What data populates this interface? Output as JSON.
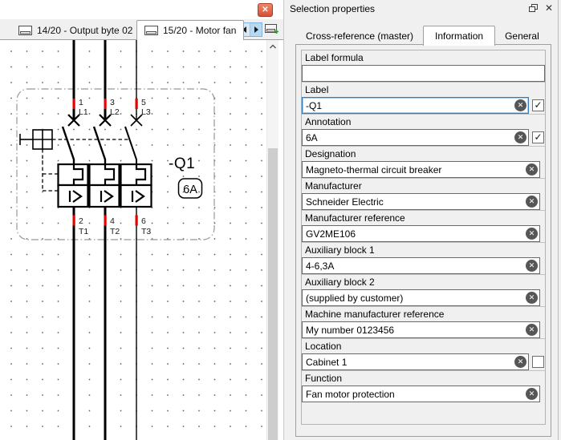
{
  "icons": {
    "close": "✕",
    "check": "✓",
    "clear": "✕"
  },
  "left_pane": {
    "tabs": [
      {
        "label": "14/20 - Output byte 02",
        "active": false
      },
      {
        "label": "15/20 - Motor fan",
        "active": true
      }
    ]
  },
  "schematic": {
    "component_label": "-Q1",
    "rating": "6A",
    "top_terminals": [
      {
        "number": "1",
        "name": "L1"
      },
      {
        "number": "3",
        "name": "L2"
      },
      {
        "number": "5",
        "name": "L3"
      }
    ],
    "bottom_terminals": [
      {
        "number": "2",
        "name": "T1"
      },
      {
        "number": "4",
        "name": "T2"
      },
      {
        "number": "6",
        "name": "T3"
      }
    ],
    "line_color": "#000000",
    "terminal_mark_color": "#e60000"
  },
  "properties_panel": {
    "title": "Selection properties",
    "tabs": [
      "Cross-reference (master)",
      "Information",
      "General"
    ],
    "active_tab": "Information",
    "fields": [
      {
        "label": "Label formula",
        "value": "",
        "checkbox": null
      },
      {
        "label": "Label",
        "value": "-Q1",
        "checkbox": true,
        "focused": true
      },
      {
        "label": "Annotation",
        "value": "6A",
        "checkbox": true
      },
      {
        "label": "Designation",
        "value": "Magneto-thermal circuit breaker",
        "checkbox": null
      },
      {
        "label": "Manufacturer",
        "value": "Schneider Electric",
        "checkbox": null
      },
      {
        "label": "Manufacturer reference",
        "value": "GV2ME106",
        "checkbox": null
      },
      {
        "label": "Auxiliary block 1",
        "value": "4-6,3A",
        "checkbox": null
      },
      {
        "label": "Auxiliary block 2",
        "value": "(supplied by customer)",
        "checkbox": null
      },
      {
        "label": "Machine manufacturer reference",
        "value": "My number 0123456",
        "checkbox": null
      },
      {
        "label": "Location",
        "value": "Cabinet 1",
        "checkbox": false
      },
      {
        "label": "Function",
        "value": "Fan motor protection",
        "checkbox": null
      }
    ]
  }
}
